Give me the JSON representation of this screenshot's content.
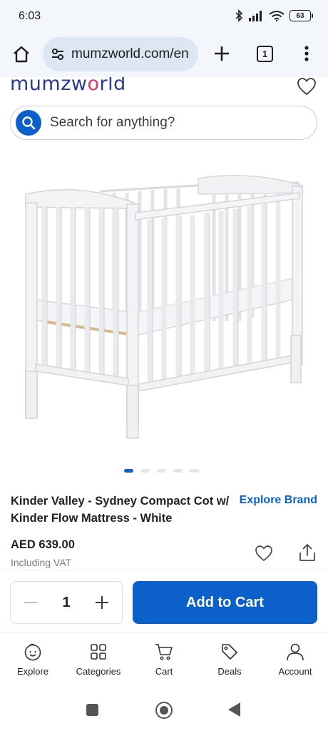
{
  "status_bar": {
    "time": "6:03",
    "battery": "63"
  },
  "browser": {
    "url": "mumzworld.com/en",
    "tab_count": "1"
  },
  "header": {
    "logo_pre": "mumzw",
    "logo_mid": "o",
    "logo_post": "rld"
  },
  "search": {
    "placeholder": "Search for anything?"
  },
  "product": {
    "image_icon": "crib-photo",
    "carousel": {
      "count": 5,
      "active": 0
    },
    "title": "Kinder Valley - Sydney Compact Cot w/ Kinder Flow Mattress - White",
    "explore_brand": "Explore Brand",
    "price": "AED 639.00",
    "vat_note": "Including VAT"
  },
  "cart": {
    "quantity": "1",
    "add_to_cart": "Add to Cart"
  },
  "bottom_nav": {
    "items": [
      {
        "label": "Explore",
        "icon": "explore-face-icon"
      },
      {
        "label": "Categories",
        "icon": "grid-icon"
      },
      {
        "label": "Cart",
        "icon": "cart-icon"
      },
      {
        "label": "Deals",
        "icon": "tag-icon"
      },
      {
        "label": "Account",
        "icon": "person-icon"
      }
    ]
  },
  "colors": {
    "accent": "#0b60c9",
    "logo_blue": "#2a3a8c",
    "logo_pink": "#e2336f"
  }
}
